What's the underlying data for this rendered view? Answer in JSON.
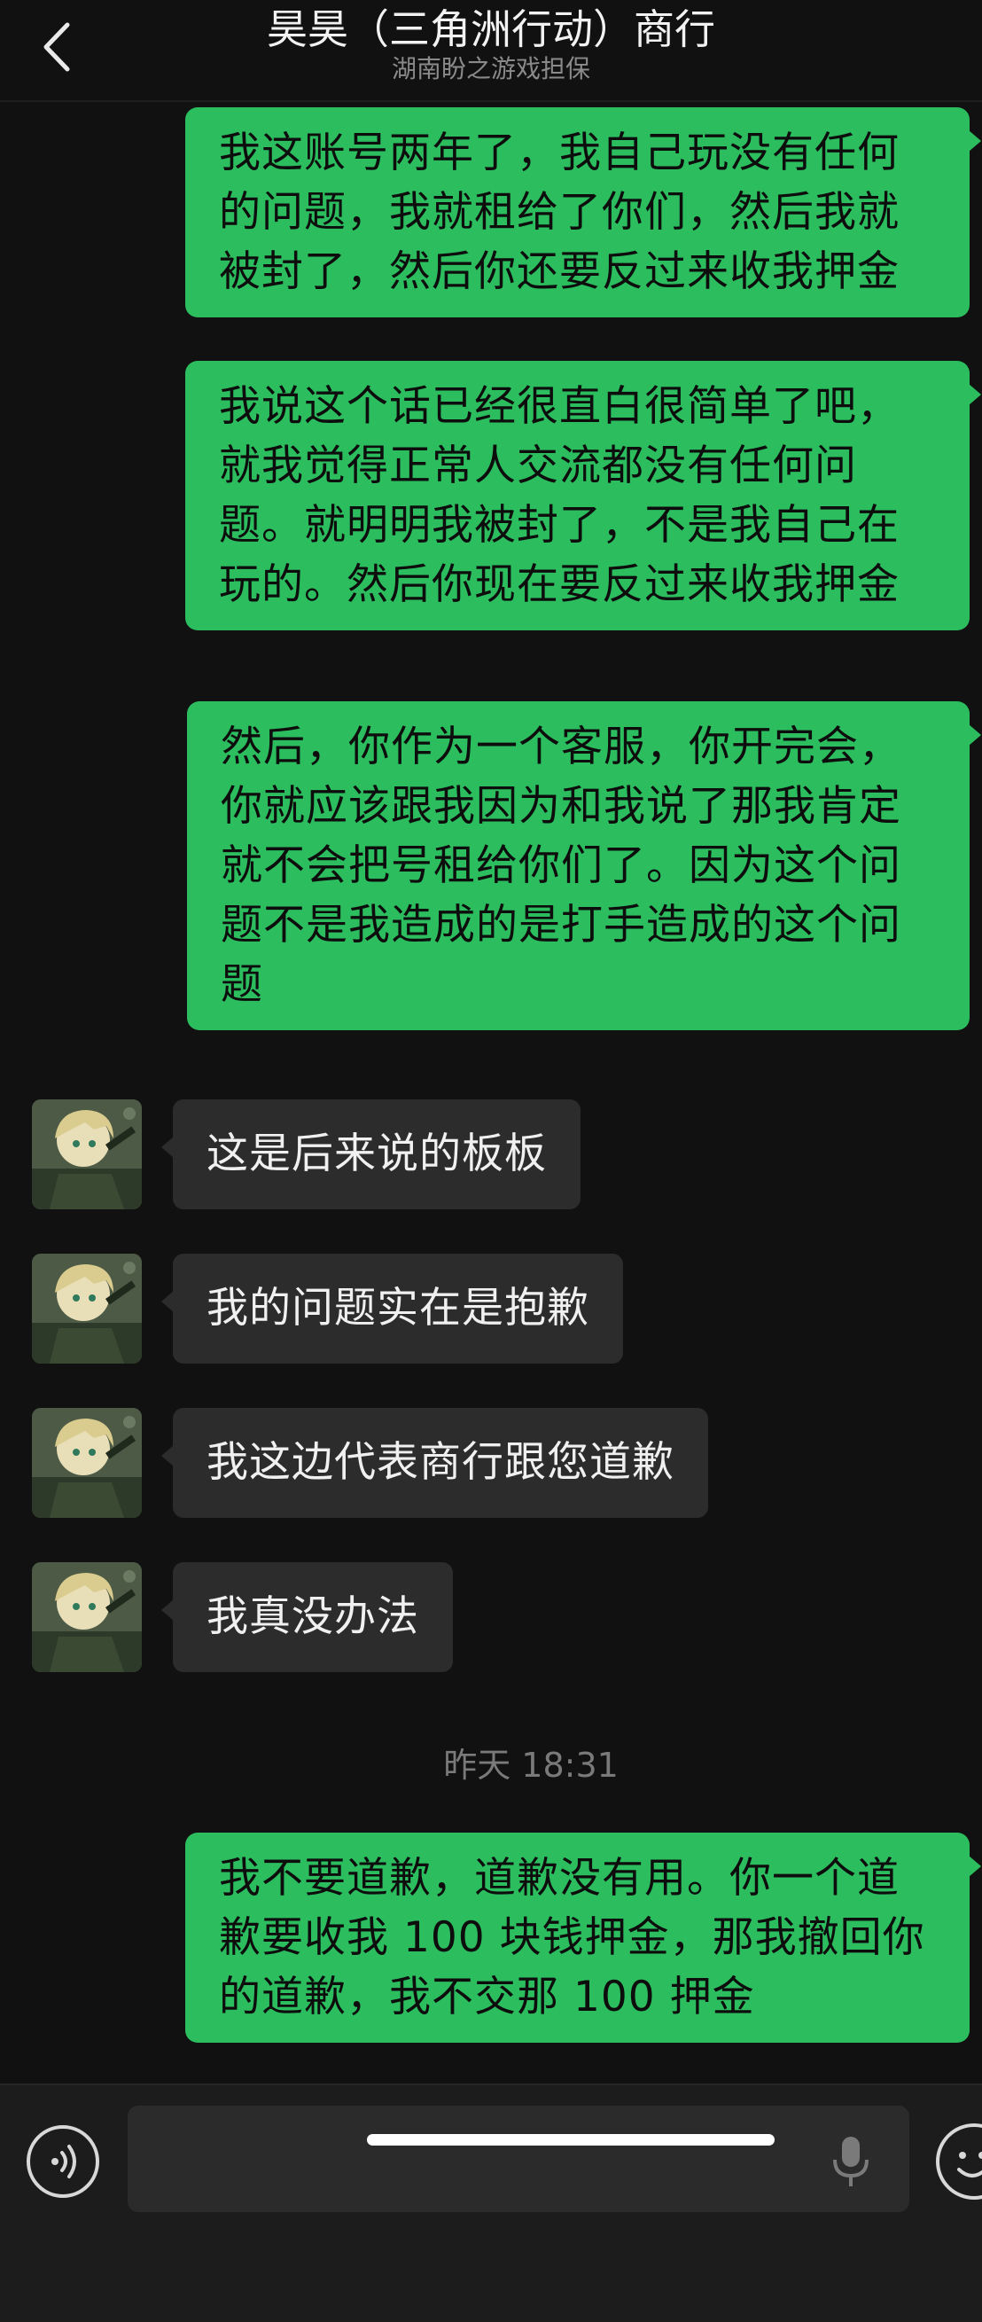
{
  "header": {
    "title": "昊昊（三角洲行动）商行",
    "subtitle": "湖南盼之游戏担保"
  },
  "messages": {
    "out_1": "我这账号两年了，我自己玩没有任何的问题，我就租给了你们，然后我就被封了，然后你还要反过来收我押金",
    "out_2": "我说这个话已经很直白很简单了吧，就我觉得正常人交流都没有任何问题。就明明我被封了，不是我自己在玩的。然后你现在要反过来收我押金",
    "out_3": "然后，你作为一个客服，你开完会，你就应该跟我因为和我说了那我肯定就不会把号租给你们了。因为这个问题不是我造成的是打手造成的这个问题",
    "in_1": "这是后来说的板板",
    "in_2": "我的问题实在是抱歉",
    "in_3": "我这边代表商行跟您道歉",
    "in_4": "我真没办法",
    "timestamp": "昨天 18:31",
    "out_4": "我不要道歉，道歉没有用。你一个道歉要收我 100 块钱押金，那我撤回你的道歉，我不交那 100 押金"
  },
  "colors": {
    "background": "#111111",
    "outgoing_bubble": "#2bbd5e",
    "incoming_bubble": "#2c2c2c"
  },
  "icons": {
    "back": "back-chevron-icon",
    "voice": "voice-icon",
    "mic": "microphone-icon",
    "emoji": "emoji-icon"
  }
}
